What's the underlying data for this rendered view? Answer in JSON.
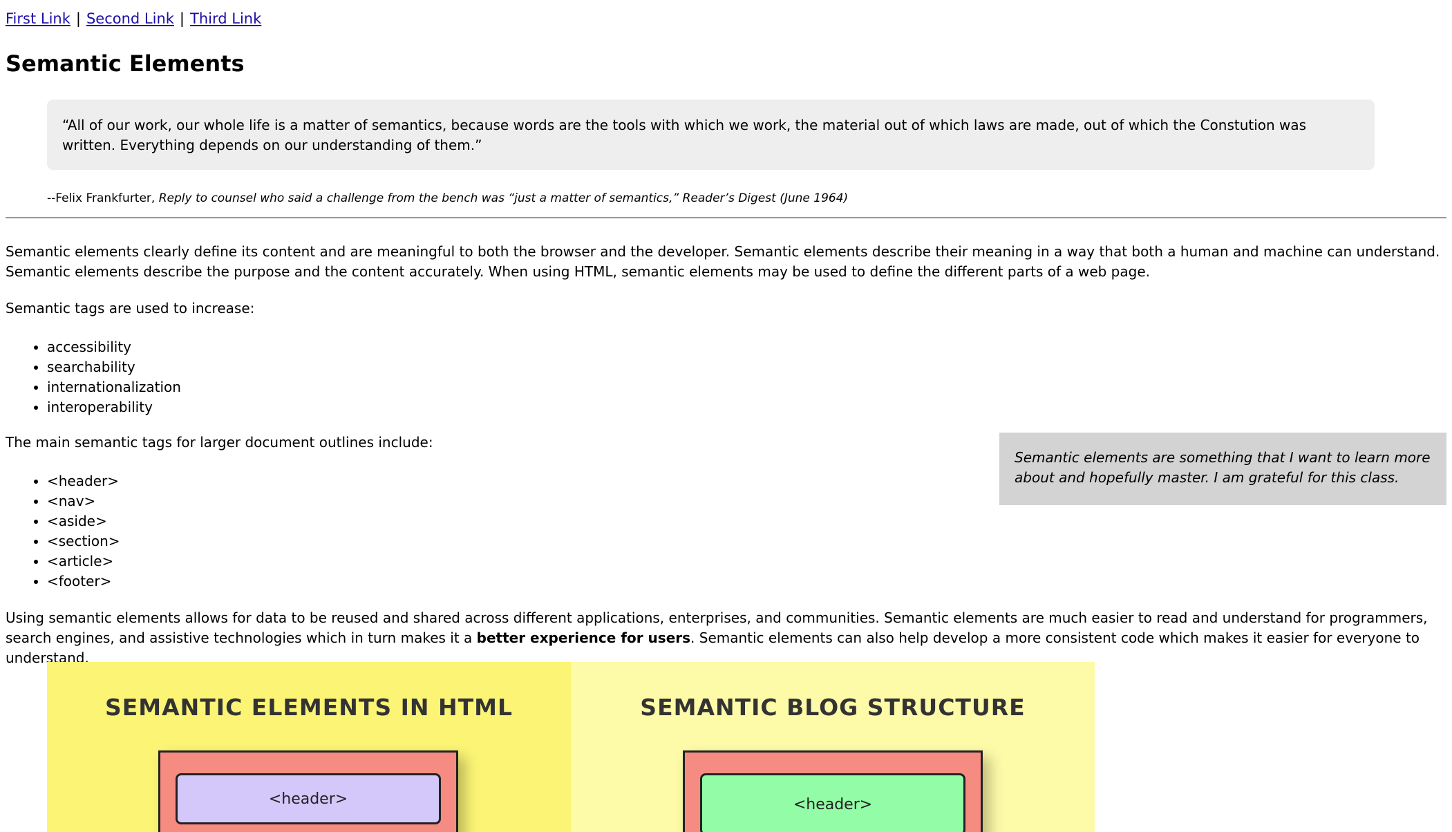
{
  "nav": {
    "links": [
      "First Link",
      "Second Link",
      "Third Link"
    ],
    "separator": "|"
  },
  "page_title": "Semantic Elements",
  "quote": {
    "text": "“All of our work, our whole life is a matter of semantics, because words are the tools with which we work, the material out of which laws are made, out of which the Constution was written. Everything depends on our understanding of them.”",
    "author": "--Felix Frankfurter, ",
    "source": "Reply to counsel who said a challenge from the bench was “just a matter of semantics,” Reader’s Digest (June 1964)"
  },
  "intro_paragraph": "Semantic elements clearly define its content and are meaningful to both the browser and the developer. Semantic elements describe their meaning in a way that both a human and machine can understand. Semantic elements describe the purpose and the content accurately. When using HTML, semantic elements may be used to define the different parts of a web page.",
  "increase_heading": "Semantic tags are used to increase:",
  "increase_items": [
    "accessibility",
    "searchability",
    "internationalization",
    "interoperability"
  ],
  "outline_heading": "The main semantic tags for larger document outlines include:",
  "outline_items": [
    "<header>",
    "<nav>",
    "<aside>",
    "<section>",
    "<article>",
    "<footer>"
  ],
  "aside_text": "Semantic elements are something that I want to learn more about and hopefully master. I am grateful for this class.",
  "closing_paragraph": {
    "before": "Using semantic elements allows for data to be reused and shared across different applications, enterprises, and communities. Semantic elements are much easier to read and understand for programmers, search engines, and assistive technologies which in turn makes it a ",
    "bold": "better experience for users",
    "after": ". Semantic elements can also help develop a more consistent code which makes it easier for everyone to understand."
  },
  "graphic": {
    "left_title": "SEMANTIC ELEMENTS IN HTML",
    "left_block": "<header>",
    "right_title": "SEMANTIC BLOG STRUCTURE",
    "right_block": "<header>",
    "colors": {
      "left_bg": "#fbf475",
      "right_bg": "#fdfaa8",
      "frame": "#f68b82",
      "left_block": "#d4c8fa",
      "right_block": "#92fda6"
    }
  }
}
